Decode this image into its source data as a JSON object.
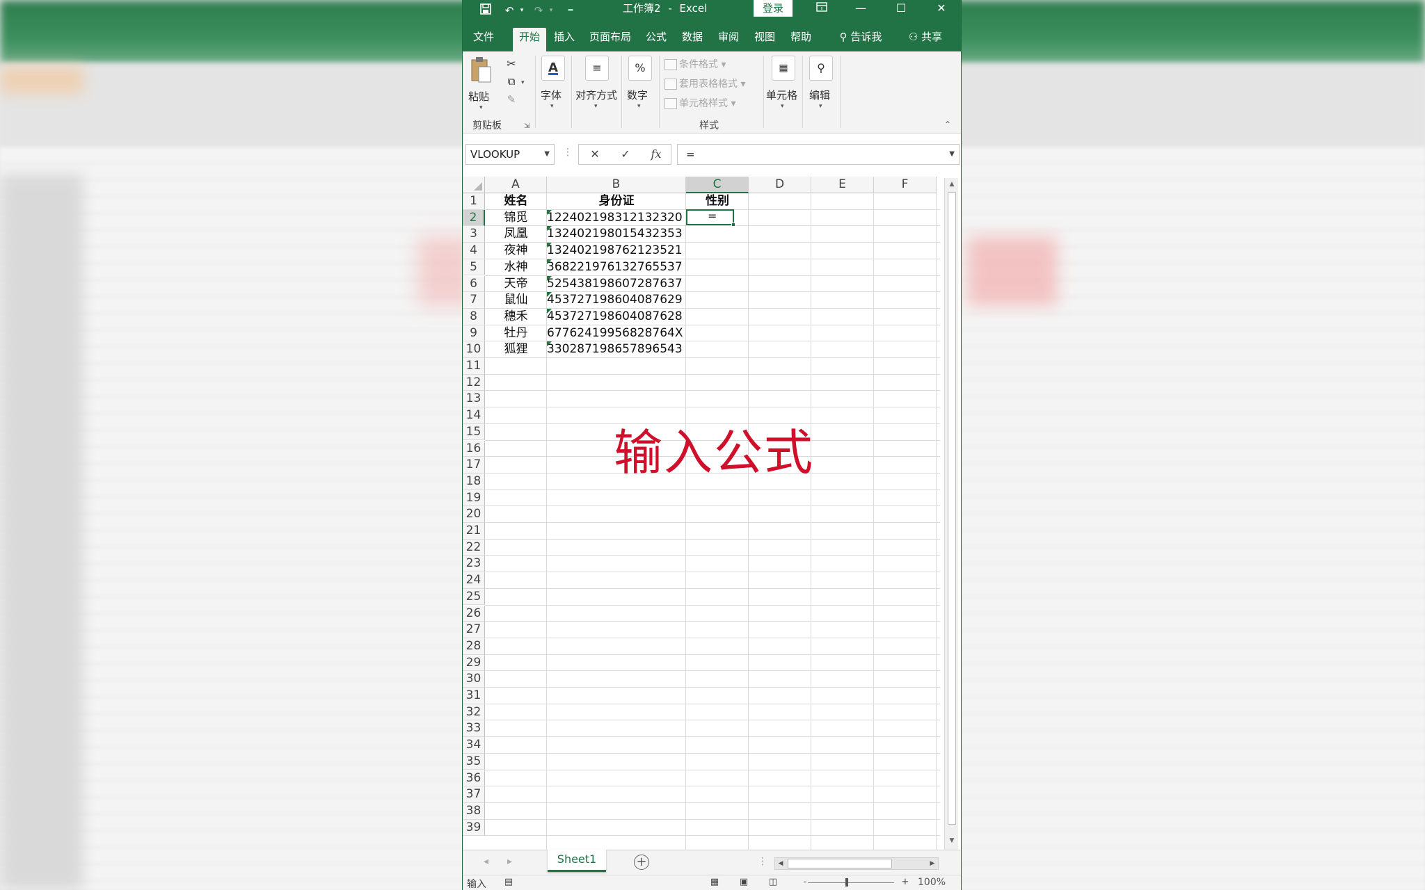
{
  "titlebar": {
    "doc_title": "工作簿2",
    "separator": "-",
    "app_name": "Excel",
    "login_label": "登录",
    "minimize_glyph": "—",
    "maximize_glyph": "☐",
    "close_glyph": "✕"
  },
  "tabs": [
    {
      "label": "文件"
    },
    {
      "label": "开始"
    },
    {
      "label": "插入"
    },
    {
      "label": "页面布局"
    },
    {
      "label": "公式"
    },
    {
      "label": "数据"
    },
    {
      "label": "审阅"
    },
    {
      "label": "视图"
    },
    {
      "label": "帮助"
    }
  ],
  "tellme_label": "告诉我",
  "share_label": "共享",
  "ribbon": {
    "paste_label": "粘贴",
    "clipboard_group": "剪贴板",
    "font_label": "字体",
    "align_label": "对齐方式",
    "number_label": "数字",
    "cond_format": "条件格式",
    "table_format": "套用表格格式",
    "cell_style": "单元格样式",
    "styles_group": "样式",
    "cells_label": "单元格",
    "edit_label": "编辑"
  },
  "formula_bar": {
    "name_box": "VLOOKUP",
    "cancel_glyph": "✕",
    "enter_glyph": "✓",
    "fx_glyph": "fx",
    "formula": "="
  },
  "columns": [
    "A",
    "B",
    "C",
    "D",
    "E",
    "F"
  ],
  "rows": [
    "1",
    "2",
    "3",
    "4",
    "5",
    "6",
    "7",
    "8",
    "9",
    "10",
    "11",
    "12",
    "13",
    "14",
    "15",
    "16",
    "17",
    "18",
    "19",
    "20",
    "21",
    "22",
    "23",
    "24",
    "25",
    "26",
    "27",
    "28",
    "29",
    "30",
    "31",
    "32",
    "33",
    "34",
    "35",
    "36",
    "37",
    "38",
    "39"
  ],
  "table": {
    "headers": [
      "姓名",
      "身份证",
      "性别"
    ],
    "records": [
      {
        "name": "锦觅",
        "id": "122402198312132320"
      },
      {
        "name": "凤凰",
        "id": "132402198015432353"
      },
      {
        "name": "夜神",
        "id": "132402198762123521"
      },
      {
        "name": "水神",
        "id": "368221976132765537"
      },
      {
        "name": "天帝",
        "id": "525438198607287637"
      },
      {
        "name": "鼠仙",
        "id": "453727198604087629"
      },
      {
        "name": "穗禾",
        "id": "453727198604087628"
      },
      {
        "name": "牡丹",
        "id": "67762419956828764X"
      },
      {
        "name": "狐狸",
        "id": "330287198657896543"
      }
    ],
    "active_cell_text": "="
  },
  "overlay_caption": "输入公式",
  "sheet_tab": "Sheet1",
  "add_sheet_glyph": "+",
  "status": {
    "mode": "输入",
    "zoom_minus": "-",
    "zoom_plus": "+",
    "zoom": "100%"
  },
  "colors": {
    "excel_green": "#217346",
    "overlay_red": "#d0102a"
  }
}
